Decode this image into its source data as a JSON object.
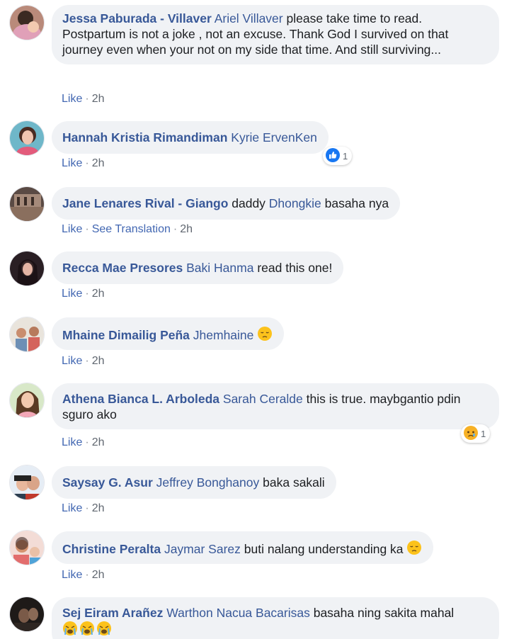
{
  "comments": [
    {
      "author": "Jessa Paburada - Villaver",
      "mention": "Ariel Villaver",
      "text": " please take time to read. Postpartum is not a joke , not an excuse. Thank God I survived on that journey even when your not on my side that time. And still surviving...",
      "like": "Like",
      "time": "2h"
    },
    {
      "author": "Hannah Kristia Rimandiman",
      "mention": "Kyrie ErvenKen",
      "text": "",
      "like": "Like",
      "time": "2h",
      "reaction": {
        "icon": "like-reaction-icon",
        "count": "1",
        "color": "#1877f2"
      }
    },
    {
      "author": "Jane Lenares Rival - Giango",
      "pre_text": " daddy ",
      "mention": "Dhongkie",
      "text": " basaha nya",
      "like": "Like",
      "translate": "See Translation",
      "time": "2h"
    },
    {
      "author": "Recca Mae Presores",
      "mention": "Baki Hanma",
      "text": " read this one!",
      "like": "Like",
      "time": "2h"
    },
    {
      "author": "Mhaine Dimailig Peña",
      "mention": "Jhemhaine",
      "text": "",
      "emoji": "pensive-face-icon",
      "like": "Like",
      "time": "2h"
    },
    {
      "author": "Athena Bianca L. Arboleda",
      "mention": "Sarah Ceralde",
      "text": " this is true. maybgantio pdin sguro ako",
      "like": "Like",
      "time": "2h",
      "reaction": {
        "icon": "sad-reaction-icon",
        "count": "1",
        "color": "#f7b125"
      }
    },
    {
      "author": "Saysay G. Asur",
      "mention": "Jeffrey Bonghanoy",
      "text": " baka sakali",
      "like": "Like",
      "time": "2h"
    },
    {
      "author": "Christine Peralta",
      "mention": "Jaymar Sarez",
      "text": " buti nalang understanding ka ",
      "emoji": "pensive-face-icon",
      "like": "Like",
      "time": "2h"
    },
    {
      "author": "Sej Eiram Arañez",
      "mention": "Warthon Nacua Bacarisas",
      "text": " basaha ning sakita mahal",
      "emoji": "crying-face-icon",
      "like": "",
      "time": ""
    }
  ],
  "colors": {
    "author": "#385898",
    "bubble": "#f0f2f5",
    "action": "#4267b2",
    "meta": "#606770"
  }
}
